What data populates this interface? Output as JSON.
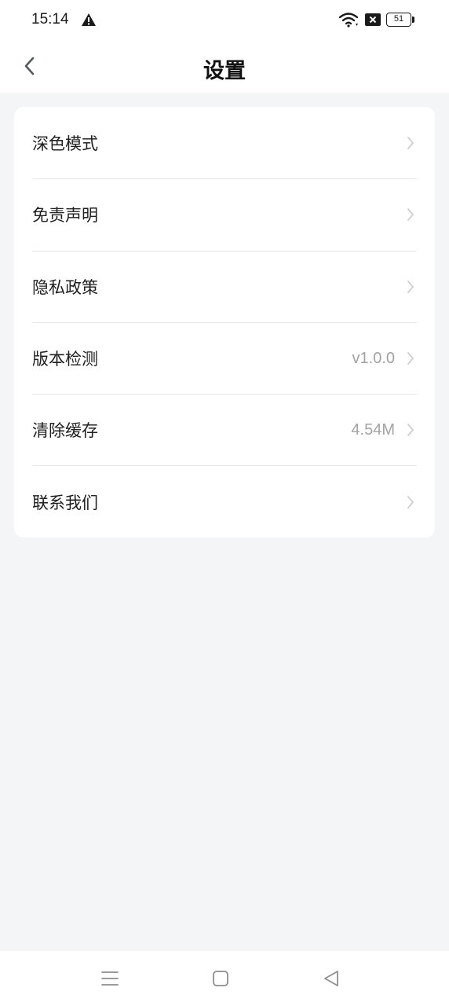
{
  "status_bar": {
    "time": "15:14",
    "battery_level": "51",
    "icons": [
      "alert-icon",
      "wifi-icon",
      "sim-off-icon",
      "battery-icon"
    ]
  },
  "header": {
    "title": "设置",
    "back_icon": "chevron-left-icon"
  },
  "settings": {
    "items": [
      {
        "label": "深色模式",
        "value": ""
      },
      {
        "label": "免责声明",
        "value": ""
      },
      {
        "label": "隐私政策",
        "value": ""
      },
      {
        "label": "版本检测",
        "value": "v1.0.0"
      },
      {
        "label": "清除缓存",
        "value": "4.54M"
      },
      {
        "label": "联系我们",
        "value": ""
      }
    ]
  },
  "system_nav": {
    "icons": [
      "menu-icon",
      "home-icon",
      "back-triangle-icon"
    ]
  },
  "colors": {
    "background": "#f4f5f7",
    "card": "#ffffff",
    "text_primary": "#1f1f1f",
    "text_secondary": "#a3a3a3",
    "divider": "#e6e6e6"
  }
}
